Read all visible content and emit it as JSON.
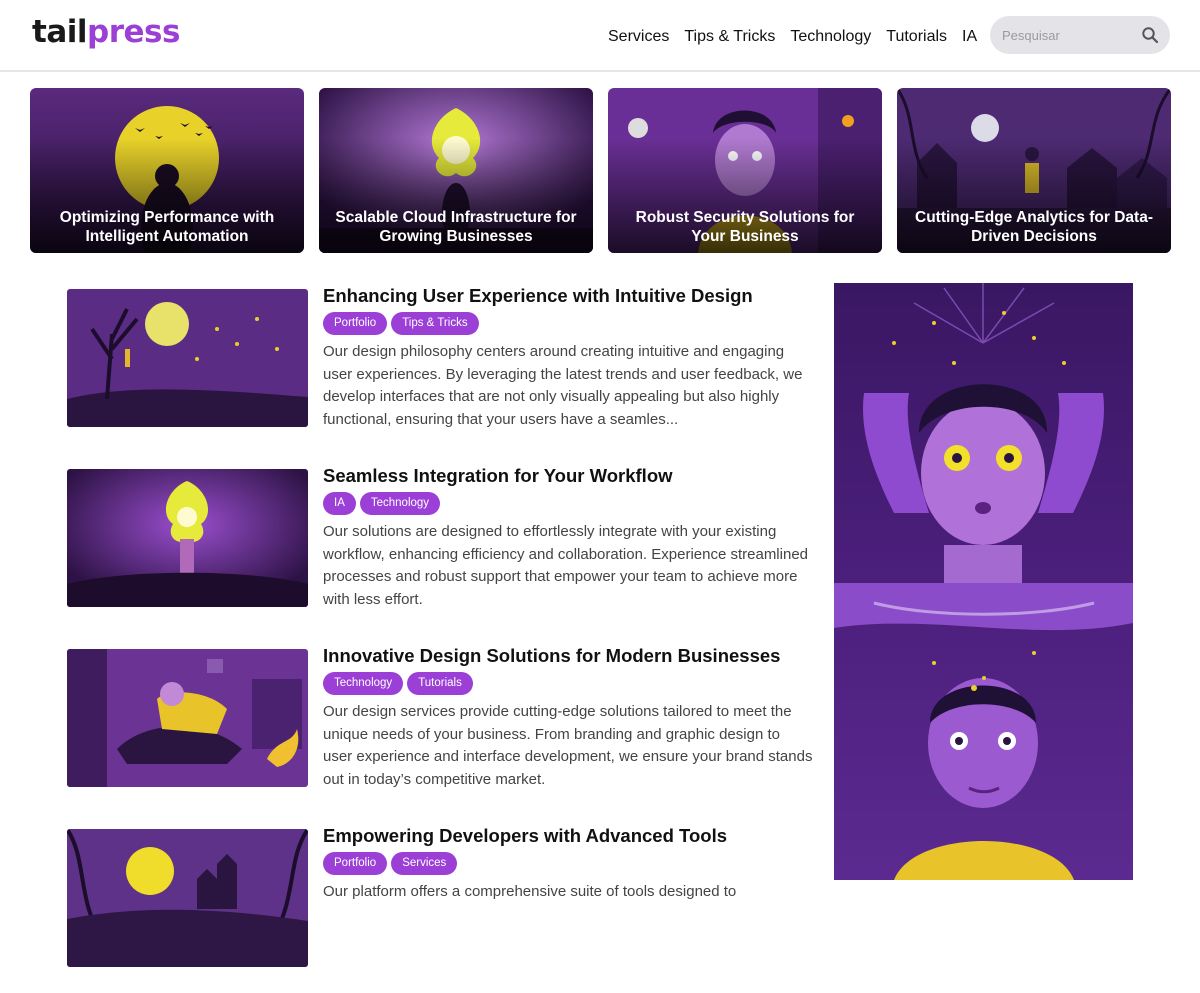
{
  "brand": {
    "part1": "tail",
    "part2": "press"
  },
  "nav": [
    "Services",
    "Tips & Tricks",
    "Technology",
    "Tutorials",
    "IA"
  ],
  "search": {
    "placeholder": "Pesquisar",
    "icon": "search-icon"
  },
  "featured": [
    {
      "title": "Optimizing Performance with Intelligent Automation"
    },
    {
      "title": "Scalable Cloud Infrastructure for Growing Businesses"
    },
    {
      "title": "Robust Security Solutions for Your Business"
    },
    {
      "title": "Cutting-Edge Analytics for Data-Driven Decisions"
    }
  ],
  "posts": [
    {
      "title": "Enhancing User Experience with Intuitive Design",
      "tags": [
        "Portfolio",
        "Tips & Tricks"
      ],
      "excerpt": "Our design philosophy centers around creating intuitive and engaging user experiences. By leveraging the latest trends and user feedback, we develop interfaces that are not only visually appealing but also highly functional, ensuring that your users have a seamles..."
    },
    {
      "title": "Seamless Integration for Your Workflow",
      "tags": [
        "IA",
        "Technology"
      ],
      "excerpt": "Our solutions are designed to effortlessly integrate with your existing workflow, enhancing efficiency and collaboration. Experience streamlined processes and robust support that empower your team to achieve more with less effort."
    },
    {
      "title": "Innovative Design Solutions for Modern Businesses",
      "tags": [
        "Technology",
        "Tutorials"
      ],
      "excerpt": "Our design services provide cutting-edge solutions tailored to meet the unique needs of your business. From branding and graphic design to user experience and interface development, we ensure your brand stands out in today’s competitive market."
    },
    {
      "title": "Empowering Developers with Advanced Tools",
      "tags": [
        "Portfolio",
        "Services"
      ],
      "excerpt": "Our platform offers a comprehensive suite of tools designed to"
    }
  ],
  "colors": {
    "accent": "#9b3fd6",
    "dark": "#1a1a1a"
  }
}
